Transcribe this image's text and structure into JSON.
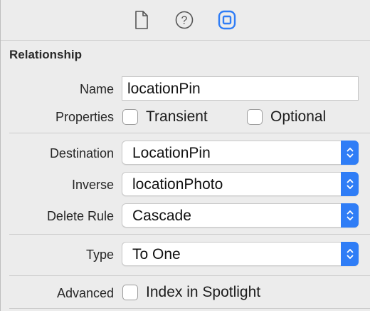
{
  "toolbar": {
    "icons": [
      "file-inspector-icon",
      "quick-help-icon",
      "data-model-inspector-icon"
    ],
    "accent_color": "#2f7df6"
  },
  "section": {
    "title": "Relationship"
  },
  "name": {
    "label": "Name",
    "value": "locationPin"
  },
  "properties": {
    "label": "Properties",
    "transient": {
      "label": "Transient",
      "checked": false
    },
    "optional": {
      "label": "Optional",
      "checked": false
    }
  },
  "destination": {
    "label": "Destination",
    "value": "LocationPin"
  },
  "inverse": {
    "label": "Inverse",
    "value": "locationPhoto"
  },
  "delete_rule": {
    "label": "Delete Rule",
    "value": "Cascade"
  },
  "type": {
    "label": "Type",
    "value": "To One"
  },
  "advanced": {
    "label": "Advanced",
    "index_spotlight": {
      "label": "Index in Spotlight",
      "checked": false
    }
  }
}
